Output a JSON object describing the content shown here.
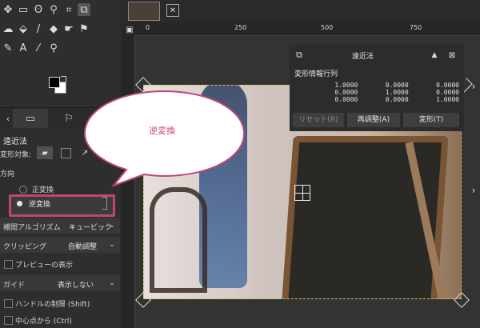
{
  "toolbox": {
    "tools": [
      {
        "icon": "move-icon",
        "glyph": "✥"
      },
      {
        "icon": "rect-select-icon",
        "glyph": "▭"
      },
      {
        "icon": "lasso-icon",
        "glyph": "ʘ"
      },
      {
        "icon": "fuzzy-select-icon",
        "glyph": "⚲"
      },
      {
        "icon": "crop-icon",
        "glyph": "⌗"
      },
      {
        "icon": "perspective-icon",
        "glyph": "⧉"
      },
      {
        "icon": "warp-icon",
        "glyph": "☁"
      },
      {
        "icon": "bucket-fill-icon",
        "glyph": "⬙"
      },
      {
        "icon": "paintbrush-icon",
        "glyph": "/"
      },
      {
        "icon": "eraser-icon",
        "glyph": "◆"
      },
      {
        "icon": "smudge-icon",
        "glyph": "☛"
      },
      {
        "icon": "clone-icon",
        "glyph": "⚑"
      },
      {
        "icon": "path-icon",
        "glyph": "✎"
      },
      {
        "icon": "text-icon",
        "glyph": "A"
      },
      {
        "icon": "color-picker-icon",
        "glyph": "⁄"
      },
      {
        "icon": "zoom-icon",
        "glyph": "⚲"
      }
    ]
  },
  "tool_options": {
    "title": "遠近法",
    "transform_target_label": "変形対象:",
    "direction_label": "方向",
    "direction_options": [
      "正変換",
      "逆変換"
    ],
    "selected_direction": "逆変換",
    "interpolation_label": "補間アルゴリズム",
    "interpolation_value": "キュービック",
    "clipping_label": "クリッピング",
    "clipping_value": "自動調整",
    "preview_label": "プレビューの表示",
    "guide_label": "ガイド",
    "guide_value": "表示しない",
    "constrain_label": "ハンドルの制限 (Shift)",
    "center_label": "中心点から (Ctrl)"
  },
  "callout": {
    "text": "逆変換"
  },
  "ruler": {
    "ticks": [
      "0",
      "250",
      "500",
      "750"
    ]
  },
  "dialog": {
    "title": "遠近法",
    "matrix_label": "変形情報行列",
    "matrix": [
      [
        "1.0000",
        "0.0000",
        "0.0000"
      ],
      [
        "0.0000",
        "1.0000",
        "0.0000"
      ],
      [
        "0.0000",
        "0.0000",
        "1.0000"
      ]
    ],
    "reset_label": "リセット(R)",
    "readjust_label": "再調整(A)",
    "transform_label": "変形(T)"
  },
  "colors": {
    "accent_pink": "#c0457a",
    "bg": "#2b2b2b"
  }
}
